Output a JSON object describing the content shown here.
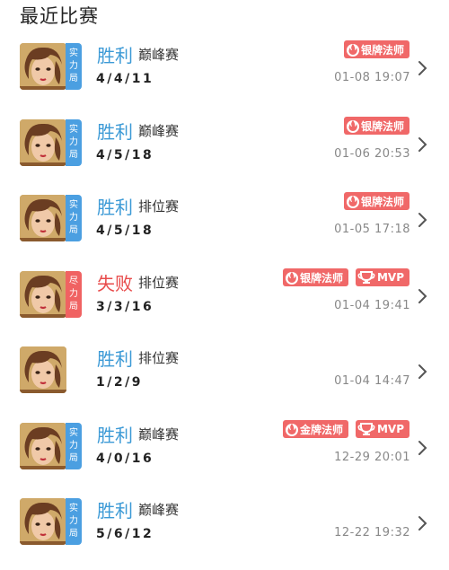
{
  "header": {
    "title": "最近比赛"
  },
  "colors": {
    "win": "#3c9ad6",
    "loss": "#e84b4b",
    "badge_blue": "#4b9fe1",
    "badge_red": "#f06262",
    "tag_red": "#f06868",
    "time_gray": "#888888"
  },
  "matches": [
    {
      "result": "胜利",
      "mode": "巅峰赛",
      "kda": "4/4/11",
      "time": "01-08 19:07",
      "badge": [
        "实",
        "力",
        "局"
      ],
      "tags": [
        "银牌法师"
      ]
    },
    {
      "result": "胜利",
      "mode": "巅峰赛",
      "kda": "4/5/18",
      "time": "01-06 20:53",
      "badge": [
        "实",
        "力",
        "局"
      ],
      "tags": [
        "银牌法师"
      ]
    },
    {
      "result": "胜利",
      "mode": "排位赛",
      "kda": "4/5/18",
      "time": "01-05 17:18",
      "badge": [
        "实",
        "力",
        "局"
      ],
      "tags": [
        "银牌法师"
      ]
    },
    {
      "result": "失败",
      "mode": "排位赛",
      "kda": "3/3/16",
      "time": "01-04 19:41",
      "badge": [
        "尽",
        "力",
        "局"
      ],
      "tags": [
        "银牌法师",
        "MVP"
      ]
    },
    {
      "result": "胜利",
      "mode": "排位赛",
      "kda": "1/2/9",
      "time": "01-04 14:47",
      "badge": [],
      "tags": []
    },
    {
      "result": "胜利",
      "mode": "巅峰赛",
      "kda": "4/0/16",
      "time": "12-29 20:01",
      "badge": [
        "实",
        "力",
        "局"
      ],
      "tags": [
        "金牌法师",
        "MVP"
      ]
    },
    {
      "result": "胜利",
      "mode": "巅峰赛",
      "kda": "5/6/12",
      "time": "12-22 19:32",
      "badge": [
        "实",
        "力",
        "局"
      ],
      "tags": []
    }
  ]
}
